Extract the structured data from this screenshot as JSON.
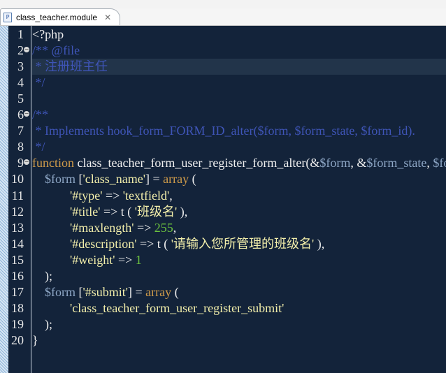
{
  "tab": {
    "icon": "php-file-icon",
    "icon_letter": "P",
    "label": "class_teacher.module",
    "close": "✕"
  },
  "editor": {
    "current_line": 3,
    "colors": {
      "background": "#13233a",
      "comment": "#3f55b8",
      "string": "#f2eeaa",
      "variable": "#8ea7c6",
      "keyword": "#cf9b4a",
      "number": "#6cc13f"
    },
    "lines": [
      {
        "n": "1",
        "fold": false,
        "tokens": [
          [
            "plain",
            "<?php"
          ]
        ]
      },
      {
        "n": "2",
        "fold": true,
        "tokens": [
          [
            "comment",
            "/** @file"
          ]
        ]
      },
      {
        "n": "3",
        "fold": false,
        "tokens": [
          [
            "comment",
            " * 注册班主任"
          ]
        ]
      },
      {
        "n": "4",
        "fold": false,
        "tokens": [
          [
            "comment",
            " */"
          ]
        ]
      },
      {
        "n": "5",
        "fold": false,
        "tokens": []
      },
      {
        "n": "6",
        "fold": true,
        "tokens": [
          [
            "comment",
            "/**"
          ]
        ]
      },
      {
        "n": "7",
        "fold": false,
        "tokens": [
          [
            "comment",
            " * Implements hook_form_FORM_ID_alter($form, $form_state, $form_id)."
          ]
        ]
      },
      {
        "n": "8",
        "fold": false,
        "tokens": [
          [
            "comment",
            " */"
          ]
        ]
      },
      {
        "n": "9",
        "fold": true,
        "tokens": [
          [
            "kw",
            "function"
          ],
          [
            "plain",
            " class_teacher_form_user_register_form_alter(&"
          ],
          [
            "var",
            "$form"
          ],
          [
            "plain",
            ", &"
          ],
          [
            "var",
            "$form_state"
          ],
          [
            "plain",
            ", "
          ],
          [
            "var",
            "$form_id"
          ],
          [
            "plain",
            ") {"
          ]
        ]
      },
      {
        "n": "10",
        "fold": false,
        "tokens": [
          [
            "plain",
            "    "
          ],
          [
            "var",
            "$form"
          ],
          [
            "plain",
            " ["
          ],
          [
            "string",
            "'class_name'"
          ],
          [
            "plain",
            "] = "
          ],
          [
            "kw",
            "array"
          ],
          [
            "plain",
            " ("
          ]
        ]
      },
      {
        "n": "11",
        "fold": false,
        "tokens": [
          [
            "plain",
            "            "
          ],
          [
            "string",
            "'#type'"
          ],
          [
            "plain",
            " => "
          ],
          [
            "string",
            "'textfield'"
          ],
          [
            "plain",
            ","
          ]
        ]
      },
      {
        "n": "12",
        "fold": false,
        "tokens": [
          [
            "plain",
            "            "
          ],
          [
            "string",
            "'#title'"
          ],
          [
            "plain",
            " => t ( "
          ],
          [
            "string",
            "'班级名'"
          ],
          [
            "plain",
            " ),"
          ]
        ]
      },
      {
        "n": "13",
        "fold": false,
        "tokens": [
          [
            "plain",
            "            "
          ],
          [
            "string",
            "'#maxlength'"
          ],
          [
            "plain",
            " => "
          ],
          [
            "num",
            "255"
          ],
          [
            "plain",
            ","
          ]
        ]
      },
      {
        "n": "14",
        "fold": false,
        "tokens": [
          [
            "plain",
            "            "
          ],
          [
            "string",
            "'#description'"
          ],
          [
            "plain",
            " => t ( "
          ],
          [
            "string",
            "'请输入您所管理的班级名'"
          ],
          [
            "plain",
            " ),"
          ]
        ]
      },
      {
        "n": "15",
        "fold": false,
        "tokens": [
          [
            "plain",
            "            "
          ],
          [
            "string",
            "'#weight'"
          ],
          [
            "plain",
            " => "
          ],
          [
            "num",
            "1"
          ]
        ]
      },
      {
        "n": "16",
        "fold": false,
        "tokens": [
          [
            "plain",
            "    );"
          ]
        ]
      },
      {
        "n": "17",
        "fold": false,
        "tokens": [
          [
            "plain",
            "    "
          ],
          [
            "var",
            "$form"
          ],
          [
            "plain",
            " ["
          ],
          [
            "string",
            "'#submit'"
          ],
          [
            "plain",
            "] = "
          ],
          [
            "kw",
            "array"
          ],
          [
            "plain",
            " ("
          ]
        ]
      },
      {
        "n": "18",
        "fold": false,
        "tokens": [
          [
            "plain",
            "            "
          ],
          [
            "string",
            "'class_teacher_form_user_register_submit'"
          ]
        ]
      },
      {
        "n": "19",
        "fold": false,
        "tokens": [
          [
            "plain",
            "    );"
          ]
        ]
      },
      {
        "n": "20",
        "fold": false,
        "tokens": [
          [
            "plain",
            "}"
          ]
        ]
      }
    ]
  }
}
